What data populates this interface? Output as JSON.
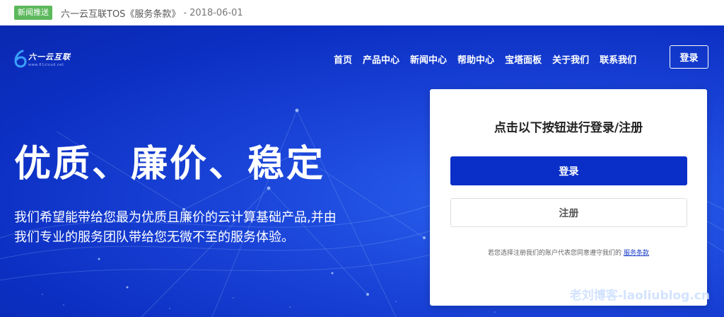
{
  "news": {
    "badge": "新闻推送",
    "title": "六一云互联TOS《服务条款》",
    "separator": "-",
    "date": "2018-06-01"
  },
  "brand": {
    "name_cn": "六一云互联",
    "name_en": "www.61cloud.net"
  },
  "nav": {
    "items": [
      "首页",
      "产品中心",
      "新闻中心",
      "帮助中心",
      "宝塔面板",
      "关于我们",
      "联系我们"
    ],
    "login": "登录"
  },
  "hero": {
    "headline": "优质、廉价、稳定",
    "subtitle": "我们希望能带给您最为优质且廉价的云计算基础产品,并由我们专业的服务团队带给您无微不至的服务体验。"
  },
  "auth_card": {
    "title": "点击以下按钮进行登录/注册",
    "login_button": "登录",
    "register_button": "注册",
    "note_prefix": "若您选择注册我们的账户代表您同意遵守我们的",
    "terms_link": "服务条款"
  },
  "watermark": "老刘博客-laoliublog.cn",
  "colors": {
    "hero_blue": "#1a44d8",
    "primary_button": "#0a2fc9",
    "news_badge": "#5cb85c"
  }
}
